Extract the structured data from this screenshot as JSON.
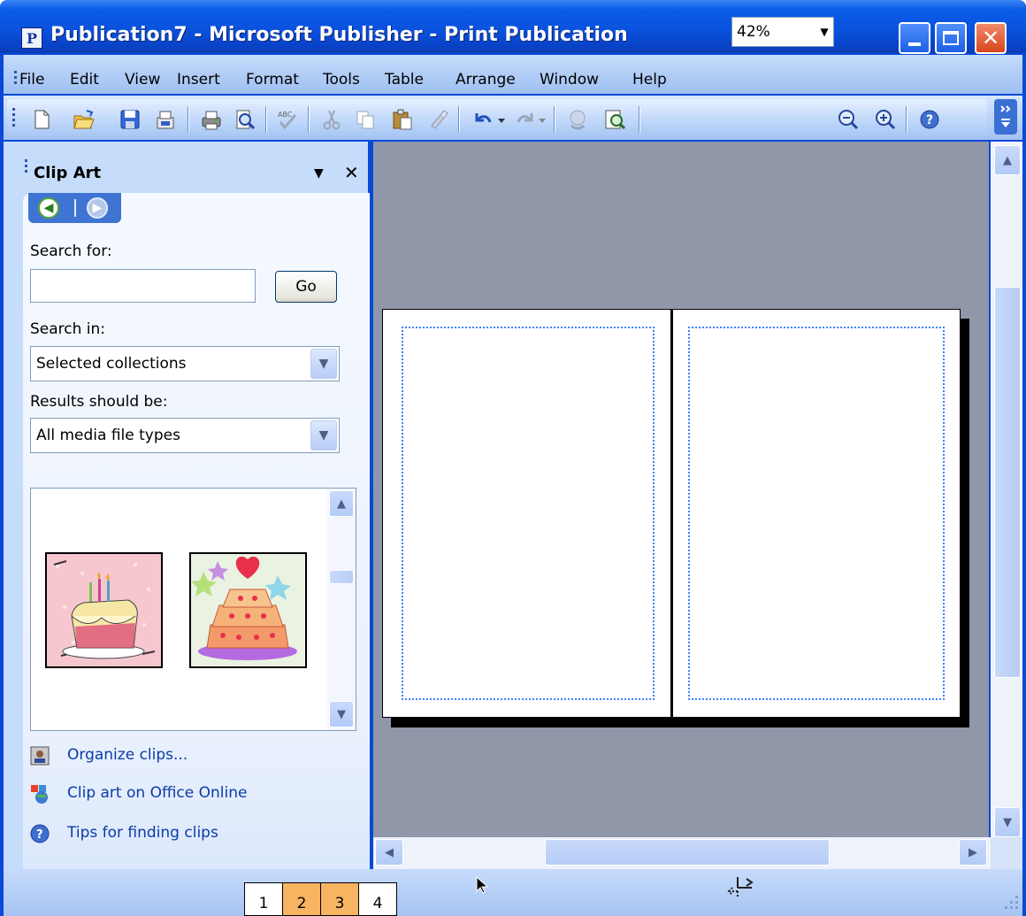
{
  "window": {
    "title": "Publication7 - Microsoft Publisher - Print Publication",
    "icon_letter": "P"
  },
  "title_buttons": {
    "minimize": "minimize-icon",
    "maximize": "maximize-icon",
    "close": "✕"
  },
  "menu": [
    "File",
    "Edit",
    "View",
    "Insert",
    "Format",
    "Tools",
    "Table",
    "Arrange",
    "Window",
    "Help"
  ],
  "toolbar": {
    "icons": [
      "new-icon",
      "open-icon",
      "save-icon",
      "permission-icon",
      "print-icon",
      "print-preview-icon",
      "spelling-icon",
      "cut-icon",
      "copy-icon",
      "paste-icon",
      "format-painter-icon",
      "undo-icon",
      "redo-icon",
      "hyperlink-icon",
      "zoom-icon",
      "zoom-out-icon",
      "zoom-in-icon",
      "help-icon"
    ],
    "zoom": "42%"
  },
  "task_pane": {
    "title": "Clip Art",
    "search_label": "Search for:",
    "search_value": "",
    "go_label": "Go",
    "search_in_label": "Search in:",
    "search_in_value": "Selected collections",
    "results_label": "Results should be:",
    "results_value": "All media file types",
    "clips": [
      "birthday-cake-clip",
      "decorated-cake-clip"
    ],
    "links": [
      "Organize clips...",
      "Clip art on Office Online",
      "Tips for finding clips"
    ]
  },
  "status": {
    "pages": [
      "1",
      "2",
      "3",
      "4"
    ],
    "active_pages": [
      "2",
      "3"
    ]
  },
  "colors": {
    "title_blue": "#0a52de",
    "menu_bg": "#c4dbfb",
    "workspace": "#9097a9",
    "guide": "#3f82ff",
    "active_page": "#f7b461"
  }
}
